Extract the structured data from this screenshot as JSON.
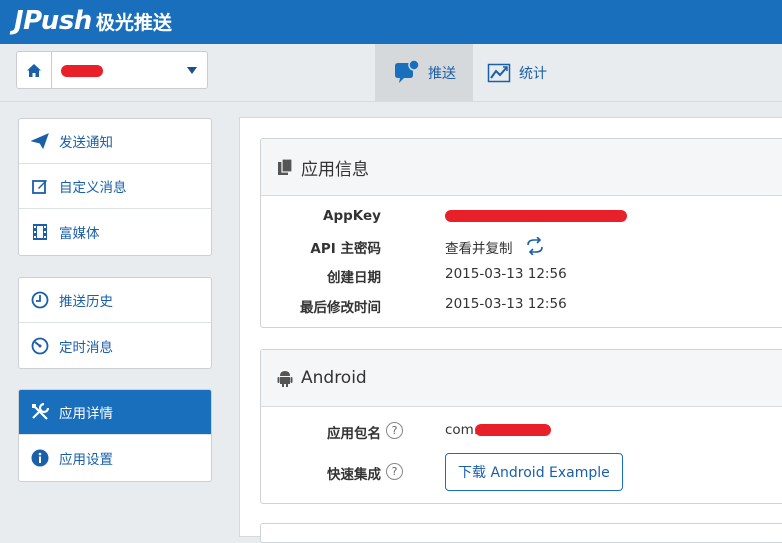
{
  "header": {
    "logo_main": "JPush",
    "logo_sub": "极光推送"
  },
  "toolbar": {
    "app_select_value": "",
    "tabs": [
      {
        "label": "推送",
        "icon": "chat-bubble-icon",
        "active": true
      },
      {
        "label": "统计",
        "icon": "line-chart-icon",
        "active": false
      }
    ]
  },
  "sidebar": {
    "group1": [
      {
        "label": "发送通知",
        "icon": "paper-plane-icon"
      },
      {
        "label": "自定义消息",
        "icon": "edit-icon"
      },
      {
        "label": "富媒体",
        "icon": "film-icon"
      }
    ],
    "group2": [
      {
        "label": "推送历史",
        "icon": "clock-icon"
      },
      {
        "label": "定时消息",
        "icon": "timer-icon"
      }
    ],
    "group3": [
      {
        "label": "应用详情",
        "icon": "tools-icon",
        "active": true
      },
      {
        "label": "应用设置",
        "icon": "info-icon"
      }
    ]
  },
  "app_info": {
    "title": "应用信息",
    "rows": [
      {
        "label": "AppKey",
        "value": ""
      },
      {
        "label": "API 主密码",
        "value": "查看并复制"
      },
      {
        "label": "创建日期",
        "value": "2015-03-13 12:56"
      },
      {
        "label": "最后修改时间",
        "value": "2015-03-13 12:56"
      }
    ]
  },
  "android": {
    "title": "Android",
    "package_label": "应用包名",
    "package_value": "com.",
    "integration_label": "快速集成",
    "download_button": "下载 Android Example",
    "help_glyph": "?"
  },
  "colors": {
    "brand": "#1a6fbd",
    "redaction": "#e8202a"
  }
}
